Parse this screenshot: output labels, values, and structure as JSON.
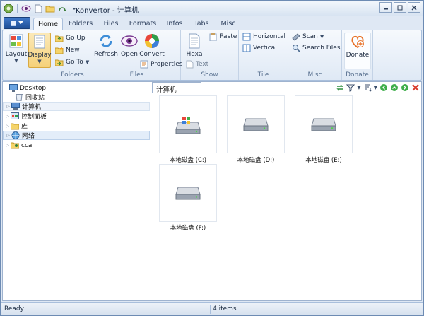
{
  "titlebar": {
    "title": "Konvertor - 计算机"
  },
  "tabs": [
    {
      "label": "Home",
      "active": true
    },
    {
      "label": "Folders"
    },
    {
      "label": "Files"
    },
    {
      "label": "Formats"
    },
    {
      "label": "Infos"
    },
    {
      "label": "Tabs"
    },
    {
      "label": "Misc"
    }
  ],
  "ribbon": {
    "layout": "Layout",
    "display": "Display",
    "go_up": "Go Up",
    "new": "New",
    "go_to": "Go To",
    "folders_group": "Folders",
    "refresh": "Refresh",
    "open": "Open",
    "convert": "Convert",
    "properties": "Properties",
    "files_group": "Files",
    "hexa": "Hexa",
    "paste": "Paste",
    "text": "Text",
    "show_group": "Show",
    "horizontal": "Horizontal",
    "vertical": "Vertical",
    "tile_group": "Tile",
    "scan": "Scan",
    "search_files": "Search Files",
    "misc_group": "Misc",
    "donate": "Donate",
    "donate_group": "Donate"
  },
  "tree": {
    "root": "Desktop",
    "items": [
      {
        "label": "回收站"
      },
      {
        "label": "计算机"
      },
      {
        "label": "控制面板"
      },
      {
        "label": "库"
      },
      {
        "label": "网络"
      },
      {
        "label": "cca"
      }
    ]
  },
  "pane": {
    "tab_title": "计算机",
    "drives": [
      {
        "label": "本地磁盘 (C:)",
        "icon": "windows-drive-icon"
      },
      {
        "label": "本地磁盘 (D:)",
        "icon": "hard-drive-icon"
      },
      {
        "label": "本地磁盘 (E:)",
        "icon": "hard-drive-icon"
      },
      {
        "label": "本地磁盘 (F:)",
        "icon": "hard-drive-icon"
      }
    ]
  },
  "status": {
    "ready": "Ready",
    "items": "4 items"
  },
  "colors": {
    "accent": "#1f4f98",
    "frame": "#6d8bb3"
  }
}
